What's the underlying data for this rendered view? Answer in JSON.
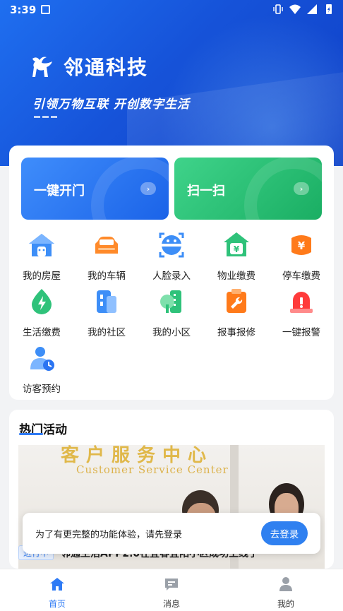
{
  "status_bar": {
    "time": "3:39"
  },
  "header": {
    "brand": "邻通科技",
    "slogan": "引领万物互联 开创数字生活"
  },
  "quick_actions": [
    {
      "label": "一键开门",
      "color": "#2a74f2"
    },
    {
      "label": "扫一扫",
      "color": "#25c174"
    }
  ],
  "services": [
    {
      "label": "我的房屋",
      "icon": "house-icon"
    },
    {
      "label": "我的车辆",
      "icon": "car-icon"
    },
    {
      "label": "人脸录入",
      "icon": "face-scan-icon"
    },
    {
      "label": "物业缴费",
      "icon": "property-fee-icon"
    },
    {
      "label": "停车缴费",
      "icon": "parking-fee-icon"
    },
    {
      "label": "生活缴费",
      "icon": "utility-fee-icon"
    },
    {
      "label": "我的社区",
      "icon": "community-icon"
    },
    {
      "label": "我的小区",
      "icon": "neighborhood-icon"
    },
    {
      "label": "报事报修",
      "icon": "repair-icon"
    },
    {
      "label": "一键报警",
      "icon": "alarm-icon"
    },
    {
      "label": "访客预约",
      "icon": "visitor-icon"
    }
  ],
  "activities": {
    "title": "热门活动",
    "photo_sign_cn": "客户服务中心",
    "photo_sign_en": "Customer Service Center",
    "badge": "进行中",
    "item_title": "邻通生活APP2.0在宜春宜阳小区成功上线了"
  },
  "toast": {
    "message": "为了有更完整的功能体验，请先登录",
    "button": "去登录"
  },
  "tabs": [
    {
      "label": "首页",
      "icon": "home-icon",
      "active": true
    },
    {
      "label": "消息",
      "icon": "message-icon",
      "active": false
    },
    {
      "label": "我的",
      "icon": "profile-icon",
      "active": false
    }
  ],
  "colors": {
    "primary": "#2f7bf5",
    "hero": "#1653d9"
  }
}
